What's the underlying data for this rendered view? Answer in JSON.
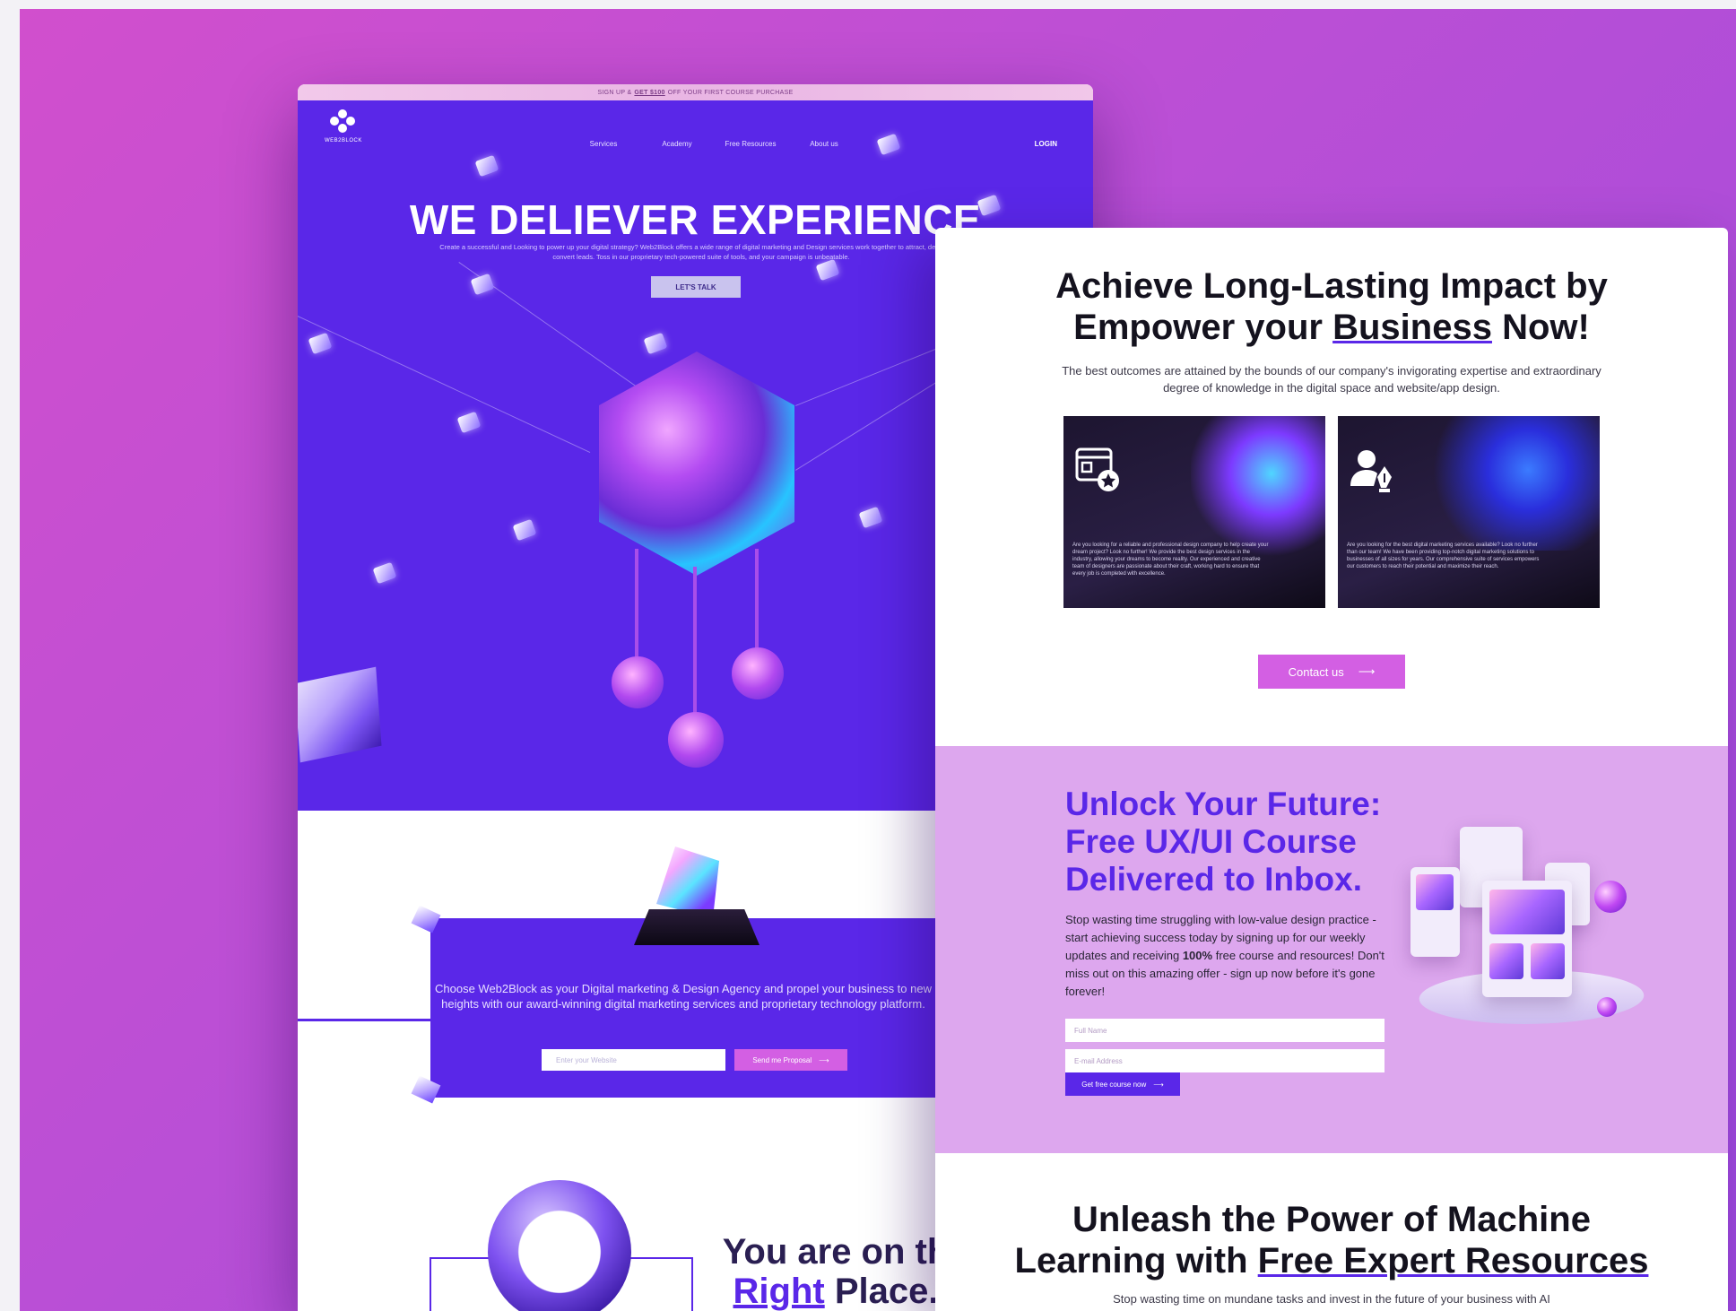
{
  "left_page": {
    "promo": {
      "prefix": "SIGN UP &",
      "highlight": "GET $100",
      "suffix": "OFF YOUR FIRST COURSE PURCHASE"
    },
    "logo_text": "WEB2BLOCK",
    "nav": [
      "Services",
      "Academy",
      "Free Resources",
      "About us"
    ],
    "login": "LOGIN",
    "hero_title": "WE DELIEVER EXPERIENCE",
    "hero_sub": "Create a successful and Looking to power up your digital strategy? Web2Block offers a wide range of digital marketing and Design services work together to attract, delight, and convert leads. Toss in our proprietary tech-powered suite of tools, and your campaign is unbeatable.",
    "cta": "LET'S TALK",
    "proposal_text": "Choose Web2Block as your Digital marketing & Design Agency and propel your business to new heights with our award-winning digital marketing services and proprietary technology platform.",
    "website_placeholder": "Enter your Website",
    "proposal_button": "Send me Proposal",
    "place_line1": "You are on th",
    "place_line2_u": "Right",
    "place_line2": "Place."
  },
  "right_page": {
    "title_line1": "Achieve Long-Lasting Impact by",
    "title_line2_pre": "Empower your",
    "title_line2_u": "Business",
    "title_line2_post": "Now!",
    "description": "The best outcomes are attained by the bounds of our company's invigorating expertise and extraordinary degree of knowledge in the digital space and website/app design.",
    "cards": [
      {
        "icon": "browser-star-icon",
        "text": "Are you looking for a reliable and professional design company to help create your dream project? Look no further! We provide the best design services in the industry, allowing your dreams to become reality. Our experienced and creative team of designers are passionate about their craft, working hard to ensure that every job is completed with excellence."
      },
      {
        "icon": "user-pen-icon",
        "text": "Are you looking for the best digital marketing services available? Look no further than our team! We have been providing top-notch digital marketing solutions to businesses of all sizes for years. Our comprehensive suite of services empowers our customers to reach their potential and maximize their reach."
      }
    ],
    "contact_button": "Contact us",
    "unlock_title": "Unlock Your Future: Free UX/UI Course Delivered to Inbox.",
    "unlock_desc_pre": "Stop wasting time struggling with low-value design practice - start achieving success today by signing up for our weekly updates and receiving",
    "unlock_desc_bold": "100%",
    "unlock_desc_post": "free course and resources! Don't miss out on this amazing offer - sign up now before it's gone forever!",
    "fullname_placeholder": "Full Name",
    "email_placeholder": "E-mail Address",
    "course_button": "Get free course now",
    "ml_title_line1": "Unleash the Power of Machine",
    "ml_title_line2_pre": "Learning with",
    "ml_title_line2_u": "Free Expert Resources",
    "ml_desc": "Stop wasting time on mundane tasks and invest in the future of your business with AI"
  },
  "colors": {
    "brand_purple": "#5a27e8",
    "accent_pink": "#d35fe3",
    "lilac": "#dda7ee"
  }
}
